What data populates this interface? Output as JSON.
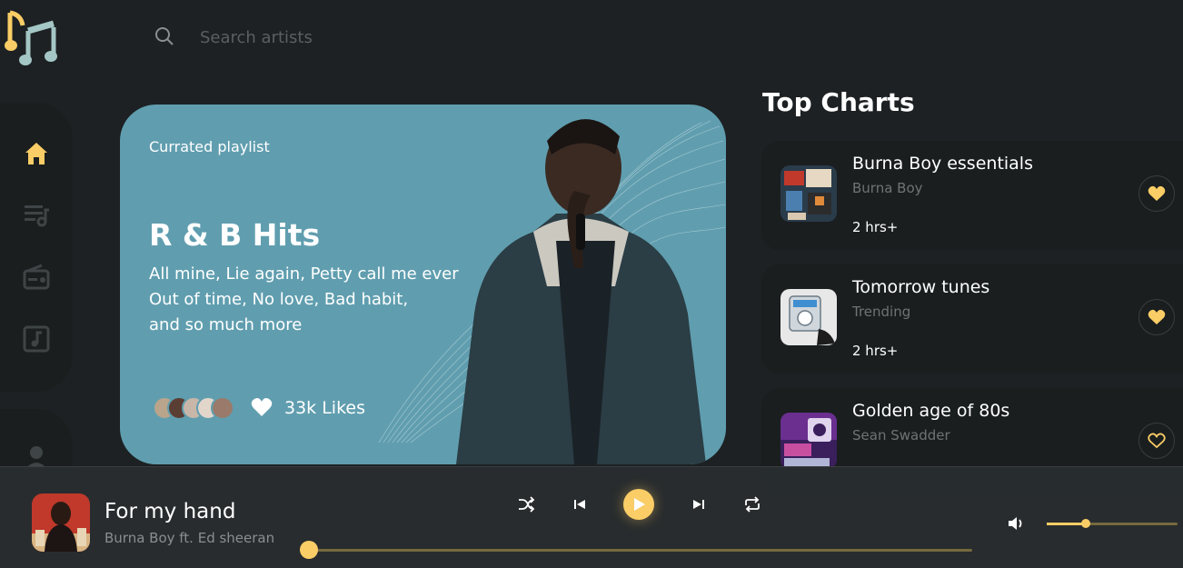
{
  "colors": {
    "accent": "#facd66",
    "background": "#1d2123",
    "hero": "#609eaf"
  },
  "search": {
    "placeholder": "Search artists"
  },
  "sidebar": {
    "items": [
      {
        "icon": "home-icon",
        "active": true
      },
      {
        "icon": "playlist-icon",
        "active": false
      },
      {
        "icon": "radio-icon",
        "active": false
      },
      {
        "icon": "videos-icon",
        "active": false
      },
      {
        "icon": "profile-icon",
        "active": false
      }
    ]
  },
  "hero": {
    "eyebrow": "Currated playlist",
    "title": "R & B Hits",
    "description_lines": [
      "All mine, Lie again, Petty call me ever",
      "Out of time, No love, Bad habit,",
      "and so much more"
    ],
    "likes": "33k Likes"
  },
  "top_charts": {
    "title": "Top Charts",
    "items": [
      {
        "title": "Burna Boy essentials",
        "artist": "Burna Boy",
        "duration": "2 hrs+",
        "liked": true
      },
      {
        "title": "Tomorrow tunes",
        "artist": "Trending",
        "duration": "2 hrs+",
        "liked": true
      },
      {
        "title": "Golden age of 80s",
        "artist": "Sean Swadder",
        "duration": "",
        "liked": false
      }
    ]
  },
  "player": {
    "title": "For my hand",
    "artist": "Burna Boy ft. Ed sheeran",
    "progress": 0.0,
    "volume": 0.3
  }
}
